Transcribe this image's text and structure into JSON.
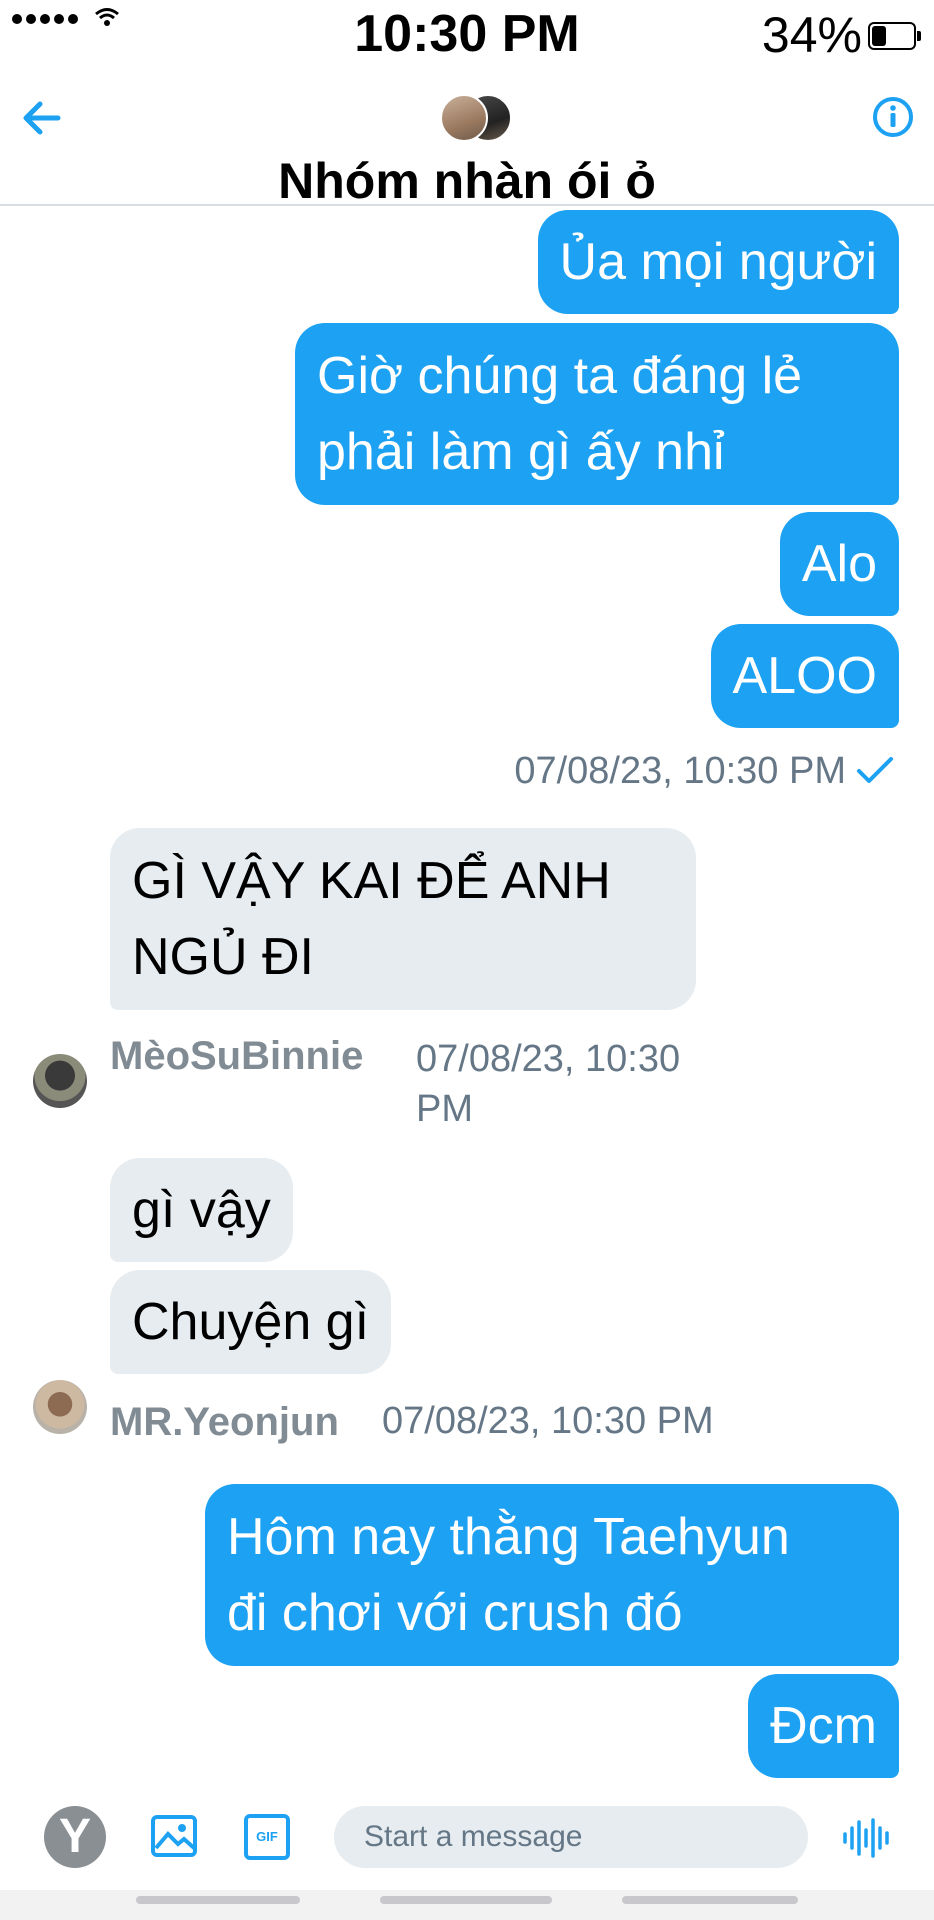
{
  "status_bar": {
    "time": "10:30 PM",
    "battery": "34%"
  },
  "header": {
    "title": "Nhóm nhàn ói ỏ"
  },
  "messages": [
    {
      "text": "Ủa mọi người"
    },
    {
      "line1": "Giờ chúng ta đáng lẻ",
      "line2": "phải làm gì ấy nhỉ"
    },
    {
      "text": "Alo"
    },
    {
      "text": "ALOO"
    },
    {
      "timestamp": "07/08/23, 10:30 PM"
    },
    {
      "line1": "GÌ VẬY KAI ĐỂ ANH",
      "line2": "NGỦ ĐI",
      "sender": "MèoSuBinnie",
      "time1": "07/08/23, 10:30",
      "time2": "PM"
    },
    {
      "text": "gì vậy"
    },
    {
      "text": "Chuyện gì",
      "sender": "MR.Yeonjun",
      "time": "07/08/23, 10:30 PM"
    },
    {
      "line1": "Hôm nay thằng Taehyun",
      "line2": "đi chơi với crush đó"
    },
    {
      "text": "Đcm"
    }
  ],
  "composer": {
    "placeholder": "Start a message",
    "y_label": "Y",
    "gif_label": "GIF"
  },
  "colors": {
    "accent": "#1da1f2",
    "incoming_bubble": "#e6ecf0",
    "meta_text": "#657786"
  }
}
